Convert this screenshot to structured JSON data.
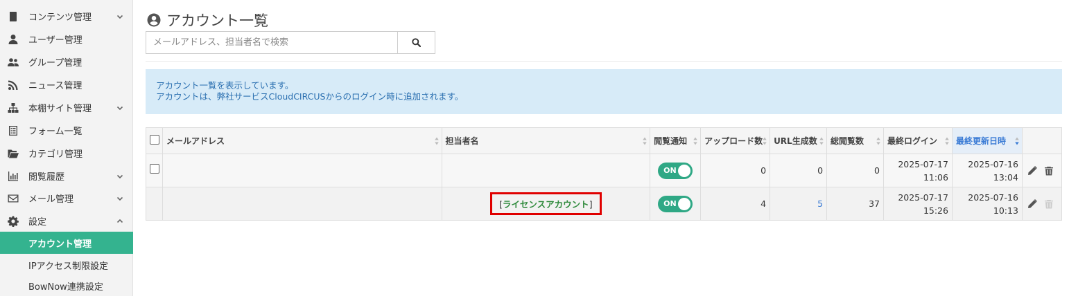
{
  "sidebar": {
    "items": [
      {
        "label": "コンテンツ管理",
        "icon": "book-icon",
        "expandable": true,
        "expanded": false
      },
      {
        "label": "ユーザー管理",
        "icon": "user-icon",
        "expandable": false
      },
      {
        "label": "グループ管理",
        "icon": "users-icon",
        "expandable": false
      },
      {
        "label": "ニュース管理",
        "icon": "rss-icon",
        "expandable": false
      },
      {
        "label": "本棚サイト管理",
        "icon": "sitemap-icon",
        "expandable": true,
        "expanded": false
      },
      {
        "label": "フォーム一覧",
        "icon": "form-icon",
        "expandable": false
      },
      {
        "label": "カテゴリ管理",
        "icon": "folder-open-icon",
        "expandable": false
      },
      {
        "label": "閲覧履歴",
        "icon": "bar-chart-icon",
        "expandable": true,
        "expanded": false
      },
      {
        "label": "メール管理",
        "icon": "envelope-icon",
        "expandable": true,
        "expanded": false
      },
      {
        "label": "設定",
        "icon": "gear-icon",
        "expandable": true,
        "expanded": true
      }
    ],
    "sub_items": [
      {
        "label": "アカウント管理",
        "active": true
      },
      {
        "label": "IPアクセス制限設定",
        "active": false
      },
      {
        "label": "BowNow連携設定",
        "active": false
      }
    ]
  },
  "page": {
    "title": "アカウント一覧",
    "title_icon": "user-circle-icon"
  },
  "search": {
    "placeholder": "メールアドレス、担当者名で検索",
    "value": ""
  },
  "info": {
    "line1": "アカウント一覧を表示しています。",
    "line2": "アカウントは、弊社サービスCloudCIRCUSからのログイン時に追加されます。"
  },
  "table": {
    "columns": [
      "メールアドレス",
      "担当者名",
      "閲覧通知",
      "アップロード数",
      "URL生成数",
      "総閲覧数",
      "最終ログイン",
      "最終更新日時"
    ],
    "sorted_column": "最終更新日時",
    "rows": [
      {
        "email": "",
        "name": "",
        "notify": "ON",
        "uploads": "0",
        "urls": "0",
        "views": "0",
        "last_login_date": "2025-07-17",
        "last_login_time": "11:06",
        "updated_date": "2025-07-16",
        "updated_time": "13:04",
        "delete_enabled": true
      },
      {
        "email": "",
        "name_prefix": "[",
        "name": "ライセンスアカウント",
        "name_suffix": "]",
        "notify": "ON",
        "uploads": "4",
        "urls": "5",
        "views": "37",
        "last_login_date": "2025-07-17",
        "last_login_time": "15:26",
        "updated_date": "2025-07-16",
        "updated_time": "10:13",
        "delete_enabled": false
      }
    ]
  },
  "colors": {
    "accent": "#34b38f",
    "toggle_on": "#2fa885",
    "info_bg": "#d7ebf8",
    "info_text": "#2a6fb0",
    "highlight_box": "#e00000",
    "license_text": "#2f8a3c",
    "link": "#3a7bd5"
  }
}
